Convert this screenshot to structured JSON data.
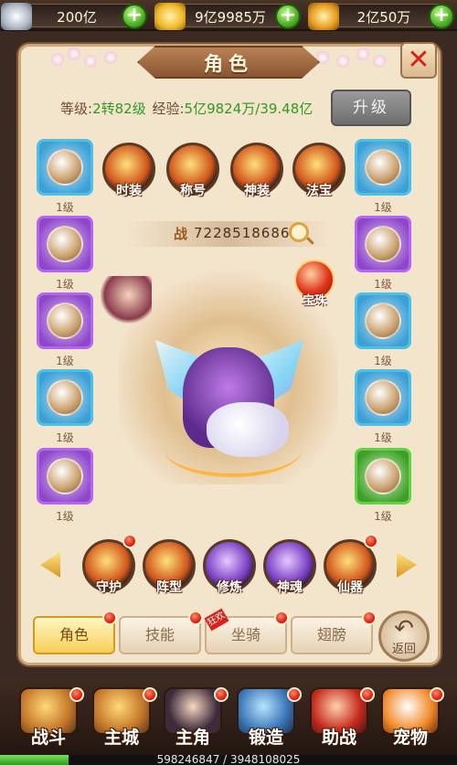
{
  "currencies": [
    {
      "icon": "silver-ingot-icon",
      "value": "200亿"
    },
    {
      "icon": "gold-ingot-icon",
      "value": "9亿9985万"
    },
    {
      "icon": "bound-gold-icon",
      "value": "2亿50万"
    }
  ],
  "panel": {
    "title": "角色",
    "level_label": "等级:",
    "level_value": "2转82级",
    "exp_label": "经验:",
    "exp_value": "5亿9824万/39.48亿",
    "upgrade_label": "升级",
    "power_glyph": "战",
    "power_value": "7228518686"
  },
  "left_slots": [
    {
      "level": "1级",
      "icon": "sword-icon",
      "rarity": "blue"
    },
    {
      "level": "1级",
      "icon": "amulet-icon",
      "rarity": "purple"
    },
    {
      "level": "1级",
      "icon": "wristguard-icon",
      "rarity": "purple"
    },
    {
      "level": "1级",
      "icon": "gauntlet-icon",
      "rarity": "blue"
    },
    {
      "level": "1级",
      "icon": "pants-icon",
      "rarity": "purple"
    }
  ],
  "right_slots": [
    {
      "level": "1级",
      "icon": "helmet-icon",
      "rarity": "blue"
    },
    {
      "level": "1级",
      "icon": "armor-icon",
      "rarity": "purple"
    },
    {
      "level": "1级",
      "icon": "bracelet-icon",
      "rarity": "blue"
    },
    {
      "level": "1级",
      "icon": "ring-icon",
      "rarity": "blue"
    },
    {
      "level": "1级",
      "icon": "boots-icon",
      "rarity": "green"
    }
  ],
  "top_features": [
    {
      "label": "时装"
    },
    {
      "label": "称号"
    },
    {
      "label": "神装"
    },
    {
      "label": "法宝"
    }
  ],
  "pearl_label": "宝珠",
  "bottom_features": [
    {
      "label": "守护"
    },
    {
      "label": "阵型"
    },
    {
      "label": "修炼"
    },
    {
      "label": "神魂"
    },
    {
      "label": "仙器"
    }
  ],
  "tabs": [
    {
      "label": "角色"
    },
    {
      "label": "技能"
    },
    {
      "label": "坐骑"
    },
    {
      "label": "翅膀"
    }
  ],
  "tab_badge": "狂欢",
  "back_label": "返回",
  "nav": [
    {
      "label": "战斗"
    },
    {
      "label": "主城"
    },
    {
      "label": "主角"
    },
    {
      "label": "锻造"
    },
    {
      "label": "助战"
    },
    {
      "label": "宠物"
    }
  ],
  "experience_bar": {
    "text": "598246847 / 3948108025",
    "progress": 0.15
  },
  "colors": {
    "accent_green": "#2f9a20",
    "close_red": "#d8231b",
    "panel_bg": "#f3e4cc"
  }
}
